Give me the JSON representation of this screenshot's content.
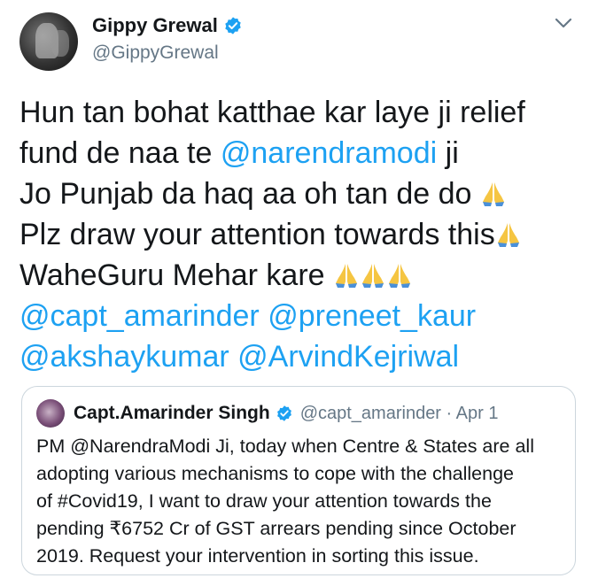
{
  "author": {
    "display_name": "Gippy Grewal",
    "handle": "@GippyGrewal"
  },
  "tweet": {
    "line1": "Hun tan bohat katthae kar laye ji relief",
    "line2_text": "fund de naa te ",
    "line2_mention": "@narendramodi",
    "line2_end": " ji",
    "line3": "Jo Punjab da haq aa oh tan de do ",
    "line4": "Plz draw your attention towards this",
    "line5": "WaheGuru Mehar kare ",
    "mention_capt": "@capt_amarinder",
    "mention_preneet": "@preneet_kaur",
    "mention_akshay": "@akshaykumar",
    "mention_arvind": "@ArvindKejriwal",
    "emoji_name": "folded-hands"
  },
  "quoted_tweet": {
    "display_name": "Capt.Amarinder Singh",
    "handle_date": "@capt_amarinder · Apr 1",
    "line1": "PM @NarendraModi Ji, today when Centre & States are all",
    "line2": "adopting various mechanisms to cope with the challenge",
    "line3": "of #Covid19, I want to draw your attention towards the",
    "line4": "pending ₹6752 Cr of GST arrears pending since October",
    "line5": "2019. Request your intervention in sorting this issue."
  },
  "colors": {
    "link": "#1da1f2",
    "secondary_text": "#657786",
    "border": "#ccd6dd"
  },
  "icons": {
    "verified": "verified-badge-icon",
    "more": "chevron-down-icon"
  }
}
